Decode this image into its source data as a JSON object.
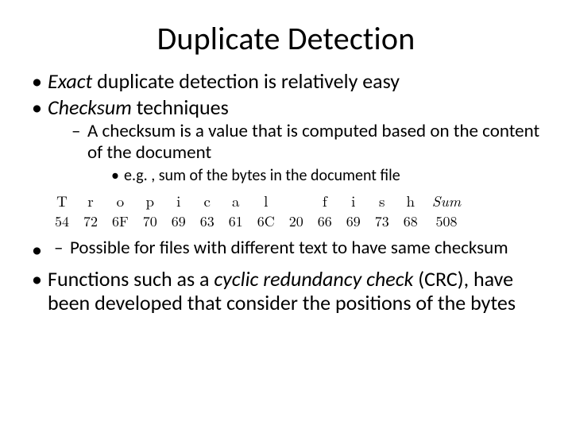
{
  "title": "Duplicate Detection",
  "bullets": {
    "b1_pre": "Exact",
    "b1_post": " duplicate detection is relatively easy",
    "b2_pre": "Checksum",
    "b2_post": " techniques",
    "b2_sub1": "A checksum is a value that is computed based on the content of the document",
    "b2_sub1_eg": "e.g. , sum of the bytes in the document file",
    "b2_sub2": "Possible for files with different text to have same checksum",
    "b3_pre": "Functions such as a ",
    "b3_em": "cyclic redundancy check",
    "b3_post": " (CRC), have been developed that consider the positions of the bytes"
  },
  "hex": {
    "chars": [
      "T",
      "r",
      "o",
      "p",
      "i",
      "c",
      "a",
      "l",
      "",
      "f",
      "i",
      "s",
      "h"
    ],
    "values": [
      "54",
      "72",
      "6F",
      "70",
      "69",
      "63",
      "61",
      "6C",
      "20",
      "66",
      "69",
      "73",
      "68"
    ],
    "sum_label": "Sum",
    "sum_value": "508"
  }
}
